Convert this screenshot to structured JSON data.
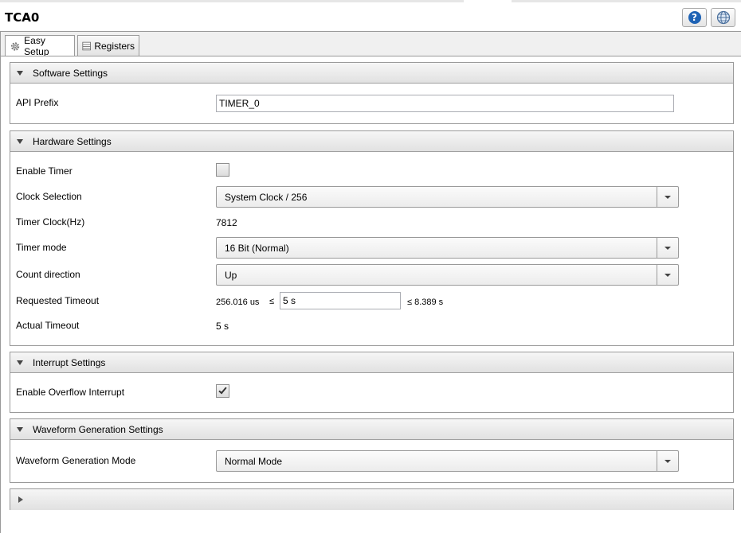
{
  "window": {
    "title": "TCA0"
  },
  "toolbar": {
    "help_icon": "help-icon",
    "web_icon": "globe-icon"
  },
  "tabs": [
    {
      "label": "Easy Setup",
      "icon": "gear-icon",
      "active": true
    },
    {
      "label": "Registers",
      "icon": "table-icon",
      "active": false
    }
  ],
  "software": {
    "header": "Software Settings",
    "api_prefix_label": "API Prefix",
    "api_prefix_value": "TIMER_0"
  },
  "hardware": {
    "header": "Hardware Settings",
    "enable_timer_label": "Enable Timer",
    "enable_timer_checked": false,
    "clock_selection_label": "Clock Selection",
    "clock_selection_value": "System Clock / 256",
    "timer_clock_label": "Timer Clock(Hz)",
    "timer_clock_value": "7812",
    "timer_mode_label": "Timer mode",
    "timer_mode_value": "16 Bit (Normal)",
    "count_direction_label": "Count direction",
    "count_direction_value": "Up",
    "requested_timeout_label": "Requested Timeout",
    "timeout_min": "256.016 us",
    "le_symbol": "≤",
    "timeout_value": "5 s",
    "timeout_max": "≤ 8.389 s",
    "actual_timeout_label": "Actual Timeout",
    "actual_timeout_value": "5 s"
  },
  "interrupt": {
    "header": "Interrupt Settings",
    "enable_overflow_label": "Enable Overflow Interrupt",
    "enable_overflow_checked": true
  },
  "waveform": {
    "header": "Waveform Generation Settings",
    "mode_label": "Waveform Generation Mode",
    "mode_value": "Normal Mode"
  }
}
